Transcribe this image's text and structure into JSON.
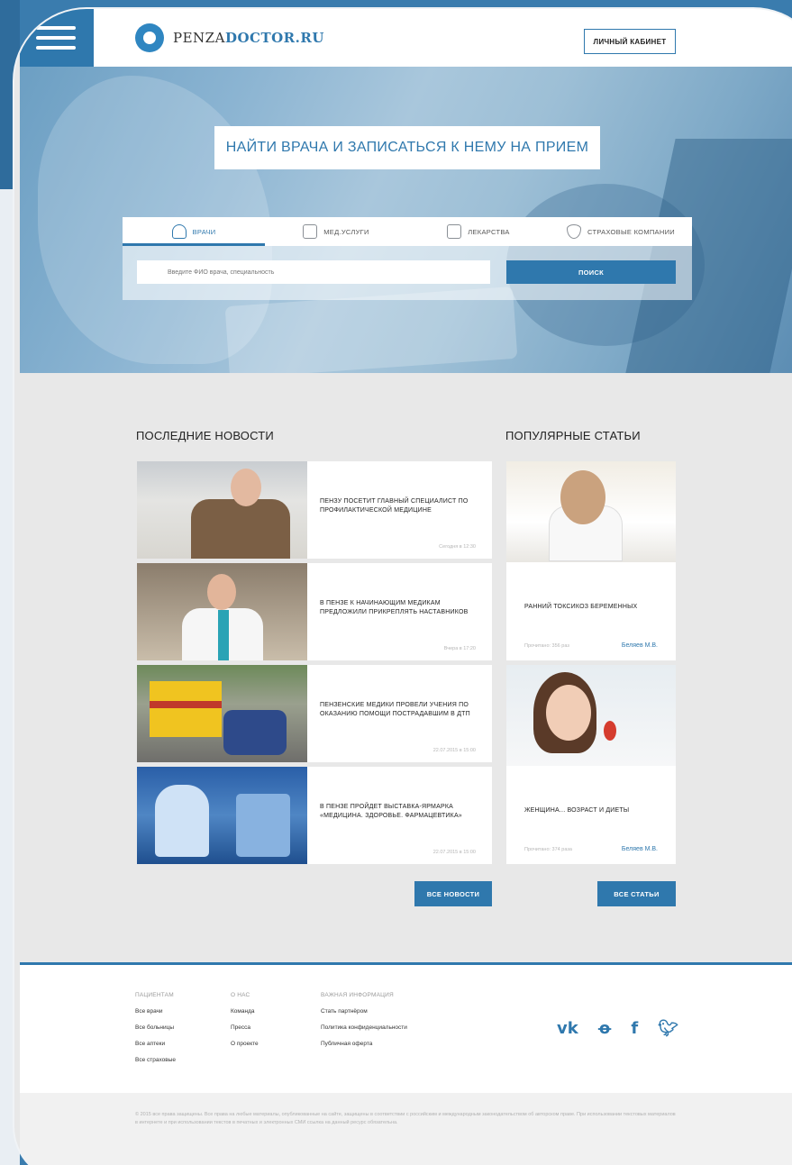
{
  "header": {
    "logo_part1": "PENZA",
    "logo_part2": "DOCTOR.RU",
    "cabinet_button": "ЛИЧНЫЙ КАБИНЕТ"
  },
  "hero": {
    "title": "НАЙТИ ВРАЧА И ЗАПИСАТЬСЯ К НЕМУ НА ПРИЕМ",
    "tabs": [
      {
        "label": "ВРАЧИ",
        "icon": "stethoscope-icon",
        "active": true
      },
      {
        "label": "МЕД.УСЛУГИ",
        "icon": "camera-icon",
        "active": false
      },
      {
        "label": "ЛЕКАРСТВА",
        "icon": "pills-icon",
        "active": false
      },
      {
        "label": "СТРАХОВЫЕ КОМПАНИИ",
        "icon": "shield-icon",
        "active": false
      }
    ],
    "search_placeholder": "Введите ФИО врача, специальность",
    "search_button": "ПОИСК"
  },
  "news": {
    "title": "ПОСЛЕДНИЕ НОВОСТИ",
    "items": [
      {
        "headline": "ПЕНЗУ ПОСЕТИТ ГЛАВНЫЙ СПЕЦИАЛИСТ ПО ПРОФИЛАКТИЧЕСКОЙ МЕДИЦИНЕ",
        "date": "Сегодня в 12:30"
      },
      {
        "headline": "В ПЕНЗЕ К НАЧИНАЮЩИМ МЕДИКАМ ПРЕДЛОЖИЛИ ПРИКРЕПЛЯТЬ НАСТАВНИКОВ",
        "date": "Вчера в 17:20"
      },
      {
        "headline": "ПЕНЗЕНСКИЕ МЕДИКИ ПРОВЕЛИ УЧЕНИЯ ПО ОКАЗАНИЮ ПОМОЩИ ПОСТРАДАВШИМ В ДТП",
        "date": "22.07.2015 в 15:00"
      },
      {
        "headline": "В ПЕНЗЕ ПРОЙДЕТ ВЫСТАВКА-ЯРМАРКА «МЕДИЦИНА. ЗДОРОВЬЕ. ФАРМАЦЕВТИКА»",
        "date": "22.07.2015 в 15:00"
      }
    ],
    "all_button": "ВСЕ НОВОСТИ"
  },
  "articles": {
    "title": "ПОПУЛЯРНЫЕ СТАТЬИ",
    "items": [
      {
        "headline": "РАННИЙ ТОКСИКОЗ БЕРЕМЕННЫХ",
        "meta": "Прочитано: 356 раз",
        "author": "Беляев М.В."
      },
      {
        "headline": "ЖЕНЩИНА... ВОЗРАСТ И ДИЕТЫ",
        "meta": "Прочитано: 374 раза",
        "author": "Беляев М.В."
      }
    ],
    "all_button": "ВСЕ СТАТЬИ"
  },
  "footer": {
    "columns": [
      {
        "head": "ПАЦИЕНТАМ",
        "links": [
          "Все врачи",
          "Все больницы",
          "Все аптеки",
          "Все страховые"
        ]
      },
      {
        "head": "О НАС",
        "links": [
          "Команда",
          "Пресса",
          "О проекте"
        ]
      },
      {
        "head": "ВАЖНАЯ ИНФОРМАЦИЯ",
        "links": [
          "Стать партнёром",
          "Политика конфиденциальности",
          "Публичная оферта"
        ]
      }
    ],
    "social": [
      "vk-icon",
      "odnoklassniki-icon",
      "facebook-icon",
      "twitter-icon"
    ],
    "copyright": "© 2015 все права защищены. Все права на любые материалы, опубликованные на сайте, защищены в соответствии с российским и международным законодательством об авторском праве. При использовании текстовых материалов в интернете и при использовании текстов в печатных и электронных СМИ ссылка на данный ресурс обязательна."
  },
  "colors": {
    "accent": "#2f78ad",
    "frame": "#3a7cae",
    "content_bg": "#e8e8e8"
  }
}
